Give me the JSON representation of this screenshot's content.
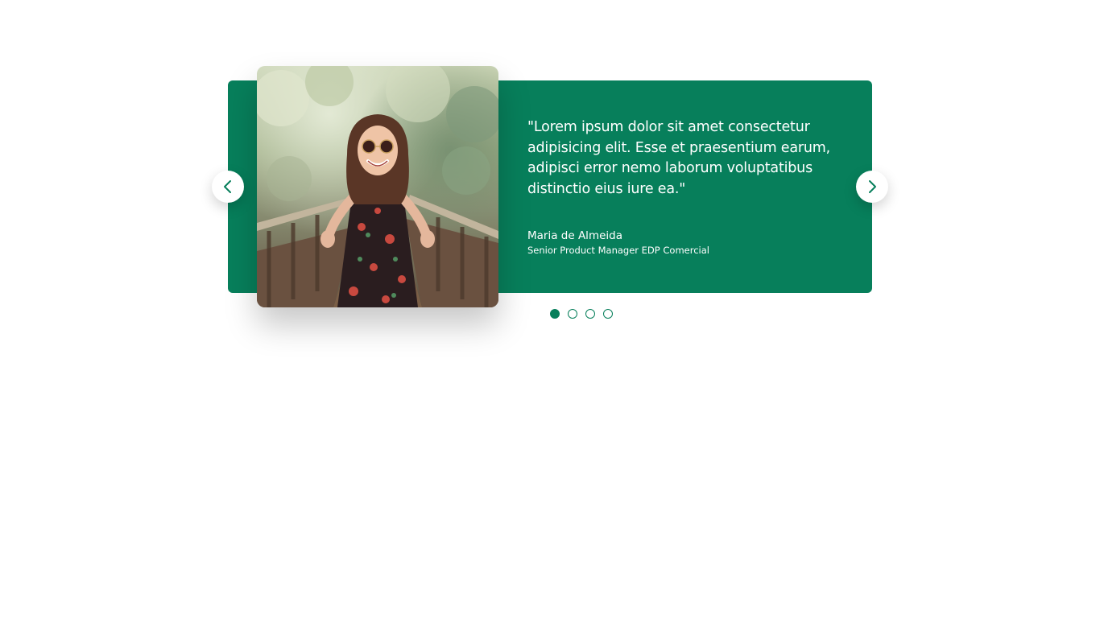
{
  "testimonial": {
    "quote": "\"Lorem ipsum dolor sit amet consectetur adipisicing elit. Esse et praesentium earum, adipisci error nemo laborum voluptatibus distinctio eius iure ea.\"",
    "author_name": "Maria de Almeida",
    "author_role": "Senior Product Manager EDP Comercial"
  },
  "navigation": {
    "prev_icon": "chevron-left-icon",
    "next_icon": "chevron-right-icon"
  },
  "pagination": {
    "total": 4,
    "active_index": 0
  },
  "colors": {
    "accent": "#077f5b",
    "text_on_accent": "#ffffff",
    "background": "#ffffff"
  }
}
